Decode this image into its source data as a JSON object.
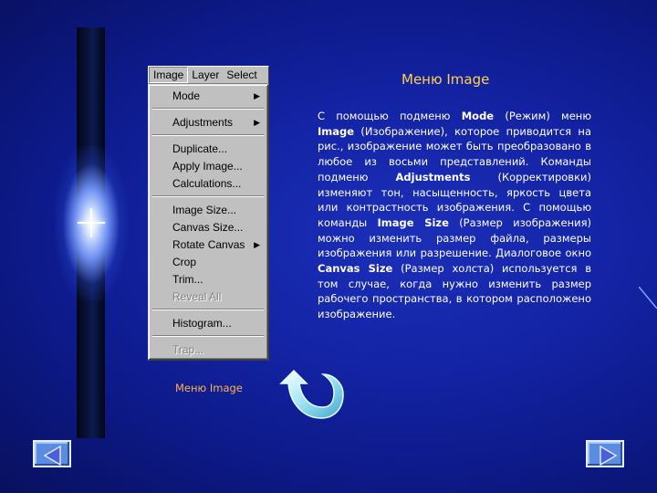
{
  "menubar": {
    "items": [
      {
        "label": "Image",
        "active": true
      },
      {
        "label": "Layer"
      },
      {
        "label": "Select"
      }
    ]
  },
  "dropdown": {
    "items": [
      {
        "label": "Mode",
        "submenu": true
      },
      {
        "label": "Adjustments",
        "submenu": true
      },
      {
        "label": "Duplicate..."
      },
      {
        "label": "Apply Image..."
      },
      {
        "label": "Calculations..."
      },
      {
        "label": "Image Size..."
      },
      {
        "label": "Canvas Size..."
      },
      {
        "label": "Rotate Canvas",
        "submenu": true
      },
      {
        "label": "Crop"
      },
      {
        "label": "Trim..."
      },
      {
        "label": "Reveal All",
        "disabled": true
      },
      {
        "label": "Histogram..."
      },
      {
        "label": "Trap...",
        "disabled": true
      }
    ]
  },
  "caption": "Меню Image",
  "slide": {
    "title": "Меню Image",
    "paragraph": {
      "p1": "С помощью подменю ",
      "mode": "Mode",
      "p2": " (Режим) меню ",
      "image": "Image",
      "p3": " (Изображение), которое приводится на рис., изображение может быть преобразовано в любое из восьми представлений. Команды подменю ",
      "adjustments": "Adjustments",
      "p4": " (Корректировки) изменяют тон, насыщенность, яркость цвета или контрастность изображения. С помощью команды ",
      "image_size": "Image Size",
      "p5": " (Размер изображения) можно изменить размер файла, размеры изображения или разрешение. Диалоговое окно ",
      "canvas_size": "Canvas Size",
      "p6": " (Размер холста) используется в том случае, когда нужно изменить размер рабочего пространства, в котором расположено изображение."
    }
  },
  "colors": {
    "title": "#ffd24a",
    "caption": "#ffb347",
    "background": "#1424a6",
    "nav_button": "#5a8de0"
  },
  "icons": {
    "prev": "triangle-left-icon",
    "next": "triangle-right-icon",
    "return": "curved-return-arrow-icon"
  }
}
